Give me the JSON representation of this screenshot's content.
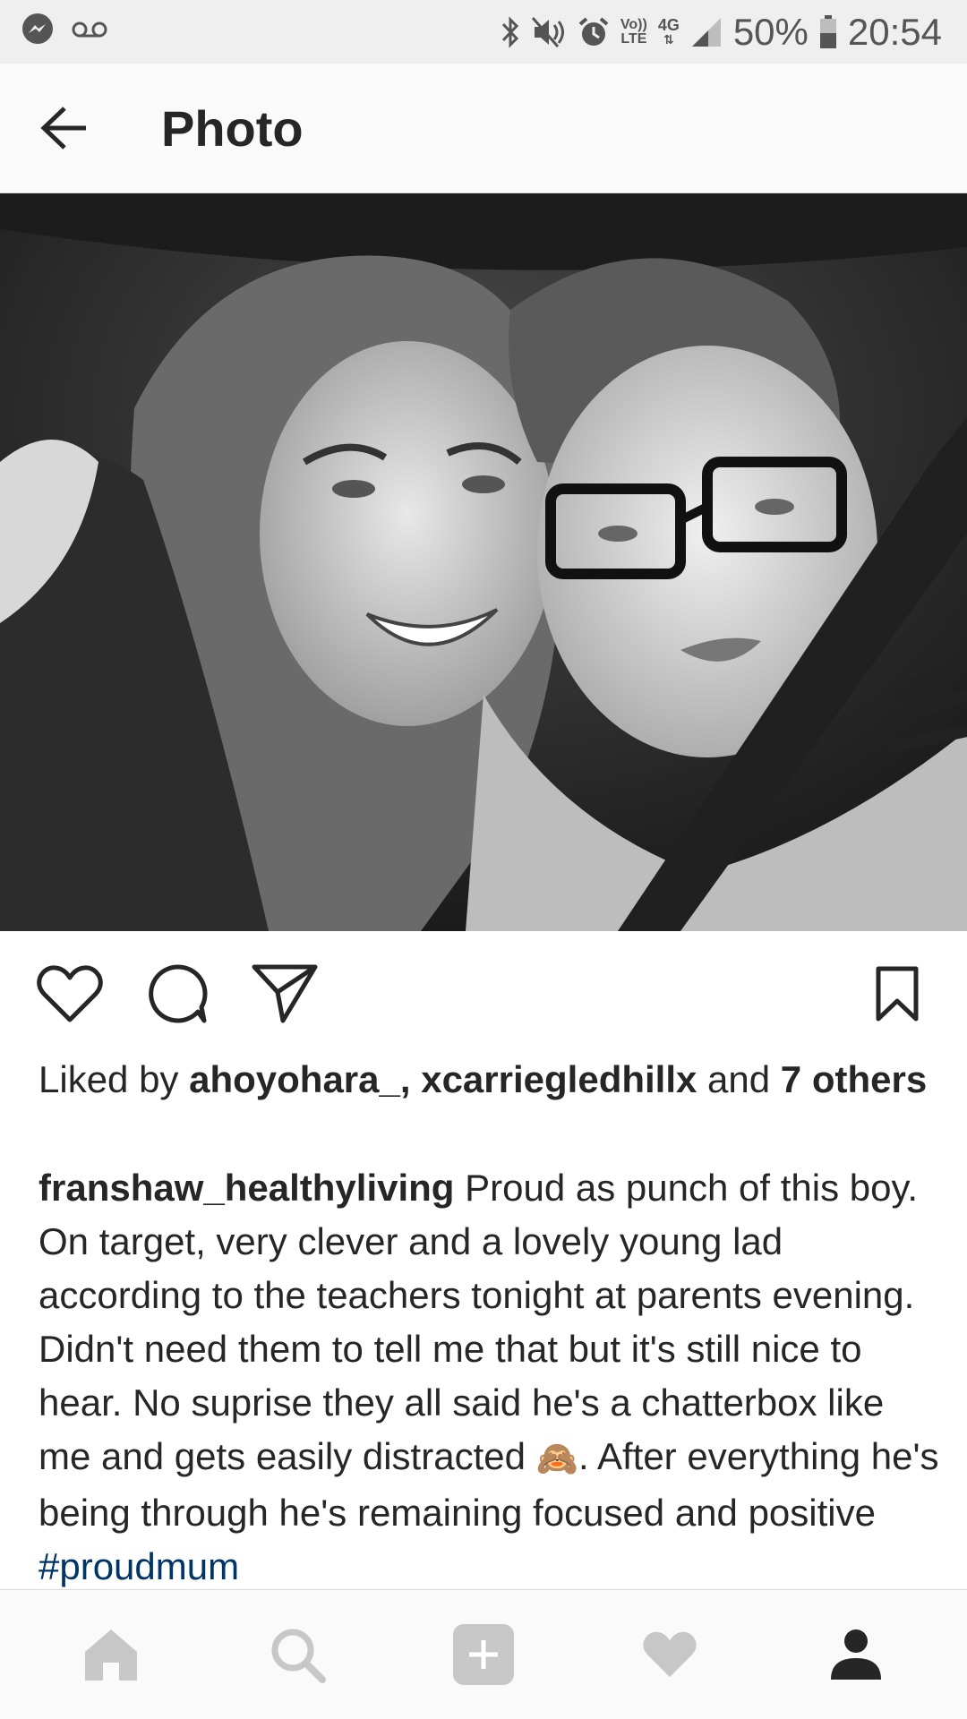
{
  "status_bar": {
    "network_small_top": "Vo))",
    "network_small_bottom": "LTE",
    "network_type": "4G",
    "battery": "50%",
    "time": "20:54",
    "icons": [
      "messenger-icon",
      "voicemail-icon",
      "bluetooth-icon",
      "mute-icon",
      "alarm-icon",
      "signal-icon",
      "battery-icon"
    ]
  },
  "app_bar": {
    "title": "Photo"
  },
  "post": {
    "likes": {
      "prefix": "Liked by ",
      "user1": "ahoyohara_",
      "separator": ", ",
      "user2": "xcarriegledhillx",
      "and": " and ",
      "others": "7 others"
    },
    "caption": {
      "username": "franshaw_healthyliving",
      "text1": " Proud as punch of this boy. On target, very clever and a lovely young lad according to the teachers tonight at parents evening.  Didn't need them to tell me that but it's still nice to hear. No suprise they all said he's a chatterbox like me and gets easily distracted ",
      "emoji": "🙈",
      "text2": ". After everything he's being through he's remaining focused and positive ",
      "hashtag": "#proudmum"
    }
  },
  "colors": {
    "hashtag": "#003569",
    "text": "#262626",
    "nav_inactive": "#c7c7c7",
    "nav_active": "#262626"
  }
}
